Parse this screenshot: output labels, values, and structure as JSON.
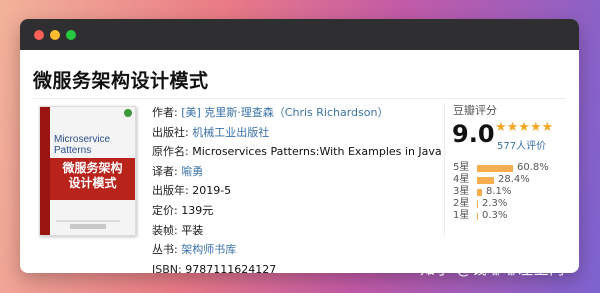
{
  "book": {
    "title": "微服务架构设计模式",
    "cover": {
      "english_title_line1": "Microservice",
      "english_title_line2": "Patterns",
      "chinese_title_line1": "微服务架构",
      "chinese_title_line2": "设计模式"
    },
    "info": {
      "author_label": "作者:",
      "author_value": "[美] 克里斯·理查森（Chris Richardson）",
      "publisher_label": "出版社:",
      "publisher_value": "机械工业出版社",
      "original_title_label": "原作名:",
      "original_title_value": "Microservices Patterns:With Examples in Java",
      "translator_label": "译者:",
      "translator_value": "喻勇",
      "year_label": "出版年:",
      "year_value": "2019-5",
      "price_label": "定价:",
      "price_value": "139元",
      "binding_label": "装帧:",
      "binding_value": "平装",
      "series_label": "丛书:",
      "series_value": "架构师书库",
      "isbn_label": "ISBN:",
      "isbn_value": "9787111624127"
    }
  },
  "rating": {
    "label": "豆瓣评分",
    "score": "9.0",
    "stars_display": "★★★★★",
    "stars_value": 4.5,
    "count_text": "577人评价",
    "accent_color": "#f7ae51",
    "distribution": [
      {
        "label": "5星",
        "percent_text": "60.8%",
        "percent": 60.8
      },
      {
        "label": "4星",
        "percent_text": "28.4%",
        "percent": 28.4
      },
      {
        "label": "3星",
        "percent_text": "8.1%",
        "percent": 8.1
      },
      {
        "label": "2星",
        "percent_text": "2.3%",
        "percent": 2.3
      },
      {
        "label": "1星",
        "percent_text": "0.3%",
        "percent": 0.3
      }
    ]
  },
  "watermark": "知乎 @钱嘟嘟左卫门"
}
